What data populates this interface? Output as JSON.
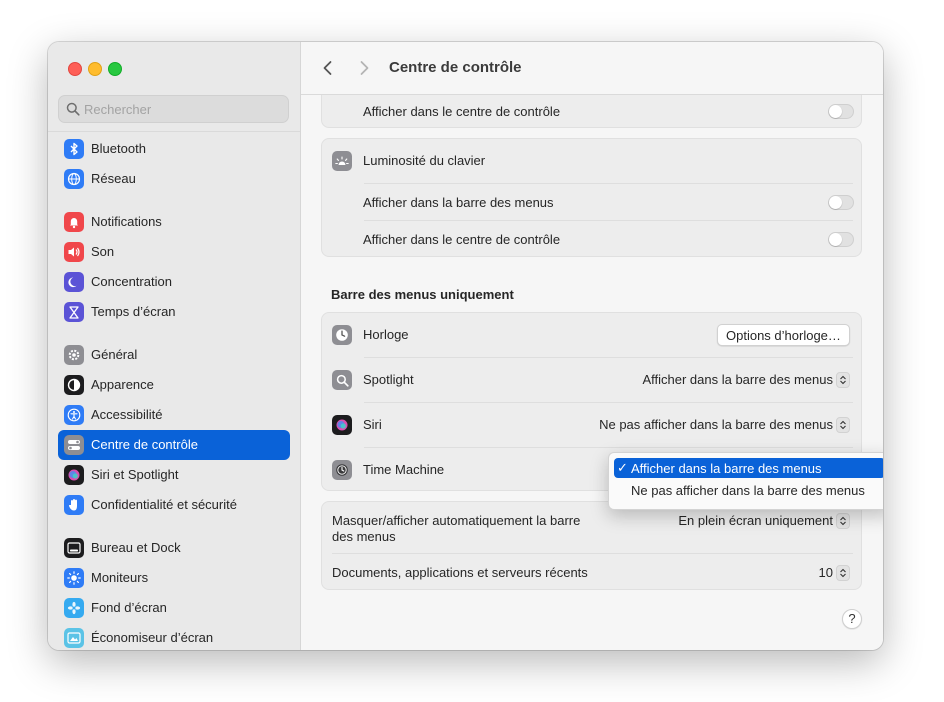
{
  "window": {
    "title": "Centre de contrôle"
  },
  "search": {
    "placeholder": "Rechercher"
  },
  "sidebar": {
    "items": [
      {
        "label": "Bluetooth",
        "icon": "bluetooth-icon",
        "color": "#2f7cf6"
      },
      {
        "label": "Réseau",
        "icon": "globe-icon",
        "color": "#2f7cf6"
      },
      {
        "label": "Notifications",
        "icon": "bell-icon",
        "color": "#f0474b"
      },
      {
        "label": "Son",
        "icon": "speaker-icon",
        "color": "#f0474b"
      },
      {
        "label": "Concentration",
        "icon": "moon-icon",
        "color": "#5b53d6"
      },
      {
        "label": "Temps d’écran",
        "icon": "hourglass-icon",
        "color": "#5b53d6"
      },
      {
        "label": "Général",
        "icon": "gear-icon",
        "color": "#8e8e93"
      },
      {
        "label": "Apparence",
        "icon": "appearance-icon",
        "color": "#1c1c1e"
      },
      {
        "label": "Accessibilité",
        "icon": "accessibility-icon",
        "color": "#2f7cf6"
      },
      {
        "label": "Centre de contrôle",
        "icon": "control-center-icon",
        "color": "#8e8e93"
      },
      {
        "label": "Siri et Spotlight",
        "icon": "siri-icon",
        "color": "#1c1c1e"
      },
      {
        "label": "Confidentialité et sécurité",
        "icon": "hand-icon",
        "color": "#2f7cf6"
      },
      {
        "label": "Bureau et Dock",
        "icon": "dock-icon",
        "color": "#1c1c1e"
      },
      {
        "label": "Moniteurs",
        "icon": "sun-icon",
        "color": "#2f7cf6"
      },
      {
        "label": "Fond d’écran",
        "icon": "wallpaper-icon",
        "color": "#35aaf0"
      },
      {
        "label": "Économiseur d’écran",
        "icon": "screensaver-icon",
        "color": "#5bc3e6"
      }
    ],
    "active_index": 9
  },
  "main": {
    "card1": {
      "row_label": "Afficher dans le centre de contrôle"
    },
    "keyboard_brightness": {
      "title": "Luminosité du clavier",
      "menu_bar_label": "Afficher dans la barre des menus",
      "control_center_label": "Afficher dans le centre de contrôle"
    },
    "menu_bar_only": {
      "heading": "Barre des menus uniquement",
      "clock": {
        "label": "Horloge",
        "button": "Options d’horloge…"
      },
      "spotlight": {
        "label": "Spotlight",
        "value": "Afficher dans la barre des menus"
      },
      "siri": {
        "label": "Siri",
        "value": "Ne pas afficher dans la barre des menus"
      },
      "time_machine": {
        "label": "Time Machine"
      }
    },
    "autohide": {
      "label_line1": "Masquer/afficher automatiquement la barre",
      "label_line2": "des menus",
      "value": "En plein écran uniquement"
    },
    "recent": {
      "label": "Documents, applications et serveurs récents",
      "value": "10"
    }
  },
  "dropdown": {
    "options": [
      {
        "label": "Afficher dans la barre des menus",
        "selected": true
      },
      {
        "label": "Ne pas afficher dans la barre des menus",
        "selected": false
      }
    ]
  },
  "help": {
    "label": "?"
  },
  "colors": {
    "accent": "#0a62d8"
  }
}
